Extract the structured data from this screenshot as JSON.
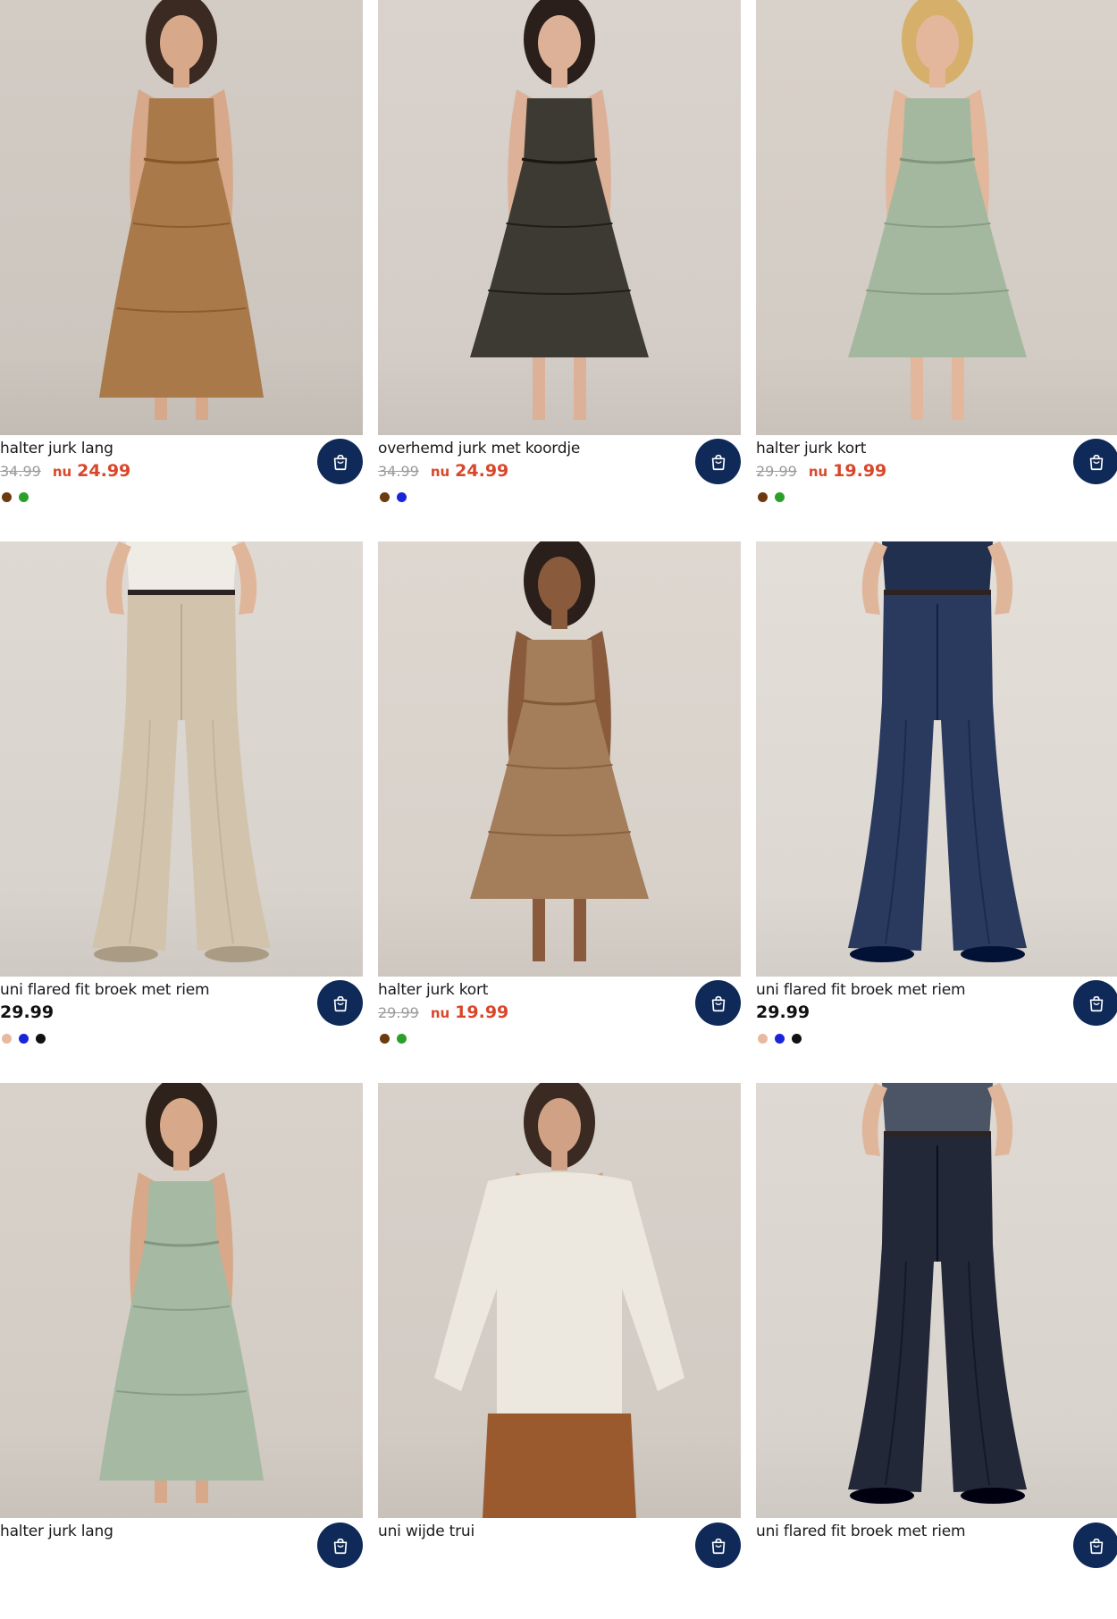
{
  "products": [
    {
      "name": "halter jurk lang",
      "old_price": "34.99",
      "now_label": "nu",
      "price": "24.99",
      "on_sale": true,
      "colors": [
        "#6b3a0e",
        "#2aa02a"
      ],
      "image": {
        "bg": "#cdc6bf",
        "garment": "dress-long",
        "color": "#a9794a",
        "top": "#a9794a",
        "skin": "#d7a98a",
        "hair": "#3a2a22"
      }
    },
    {
      "name": "overhemd jurk met koordje",
      "old_price": "34.99",
      "now_label": "nu",
      "price": "24.99",
      "on_sale": true,
      "colors": [
        "#6b3a0e",
        "#1a24d8"
      ],
      "image": {
        "bg": "#d4cdc7",
        "garment": "shirt-dress",
        "color": "#3d3a33",
        "top": "#3d3a33",
        "skin": "#dcb197",
        "hair": "#2a1f1a"
      }
    },
    {
      "name": "halter jurk kort",
      "old_price": "29.99",
      "now_label": "nu",
      "price": "19.99",
      "on_sale": true,
      "colors": [
        "#6b3a0e",
        "#2aa02a"
      ],
      "image": {
        "bg": "#d3ccc4",
        "garment": "dress-short",
        "color": "#a4b89f",
        "top": "#a4b89f",
        "skin": "#e2b79b",
        "hair": "#d6b06a"
      }
    },
    {
      "name": "uni flared fit broek met riem",
      "old_price": "",
      "now_label": "",
      "price": "29.99",
      "on_sale": false,
      "colors": [
        "#e8b9a0",
        "#1a24d8",
        "#111111"
      ],
      "image": {
        "bg": "#d9d3cd",
        "garment": "pants",
        "color": "#d2c4ac",
        "top": "#efece6",
        "skin": "#e0b69a",
        "hair": "#3a2a22"
      }
    },
    {
      "name": "halter jurk kort",
      "old_price": "29.99",
      "now_label": "nu",
      "price": "19.99",
      "on_sale": true,
      "colors": [
        "#6b3a0e",
        "#2aa02a"
      ],
      "image": {
        "bg": "#d8d1ca",
        "garment": "dress-short",
        "color": "#a47d5b",
        "top": "#a47d5b",
        "skin": "#8a5a3c",
        "hair": "#2a1f1a"
      }
    },
    {
      "name": "uni flared fit broek met riem",
      "old_price": "",
      "now_label": "",
      "price": "29.99",
      "on_sale": false,
      "colors": [
        "#e8b9a0",
        "#1a24d8",
        "#111111"
      ],
      "image": {
        "bg": "#ddd8d2",
        "garment": "pants",
        "color": "#2a3a5e",
        "top": "#22304f",
        "skin": "#e0b69a",
        "hair": "#3a2a22"
      }
    },
    {
      "name": "halter jurk lang",
      "old_price": "",
      "now_label": "",
      "price": "",
      "on_sale": false,
      "colors": [],
      "image": {
        "bg": "#d3ccc4",
        "garment": "dress-long",
        "color": "#a6b9a2",
        "top": "#a6b9a2",
        "skin": "#d7a98a",
        "hair": "#2f221b"
      }
    },
    {
      "name": "uni wijde trui",
      "old_price": "",
      "now_label": "",
      "price": "",
      "on_sale": false,
      "colors": [],
      "image": {
        "bg": "#d2cbc4",
        "garment": "sweater",
        "color": "#ece8df",
        "top": "#ece8df",
        "skin": "#d1a185",
        "hair": "#3a2a22"
      }
    },
    {
      "name": "uni flared fit broek met riem",
      "old_price": "",
      "now_label": "",
      "price": "",
      "on_sale": false,
      "colors": [],
      "image": {
        "bg": "#d9d3cd",
        "garment": "pants",
        "color": "#232838",
        "top": "#4c5566",
        "skin": "#e0b69a",
        "hair": "#3a2a22"
      }
    }
  ],
  "icons": {
    "cart": "shopping-bag-icon"
  }
}
